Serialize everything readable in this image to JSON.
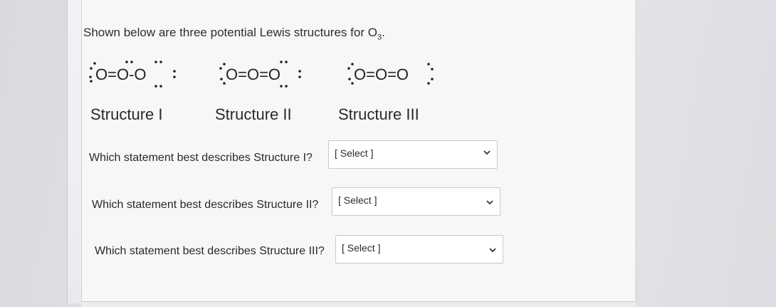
{
  "intro": {
    "text": "Shown below are three potential Lewis structures for O",
    "subscript": "3",
    "end": "."
  },
  "structures": [
    {
      "label": "Structure I",
      "formula": "O=O-O"
    },
    {
      "label": "Structure II",
      "formula": "O=O=O"
    },
    {
      "label": "Structure III",
      "formula": "O=O=O"
    }
  ],
  "questions": [
    {
      "text": "Which statement best describes Structure I?",
      "select": "[ Select ]"
    },
    {
      "text": "Which statement best describes Structure II?",
      "select": "[ Select ]"
    },
    {
      "text": "Which statement best describes Structure III?",
      "select": "[ Select ]"
    }
  ],
  "icons": {
    "dropdown": "chevron-down-icon"
  },
  "colors": {
    "card": "#f7f7f8",
    "panel": "#eeeff1",
    "border": "#c9cacd",
    "text": "#2b2b2b"
  }
}
